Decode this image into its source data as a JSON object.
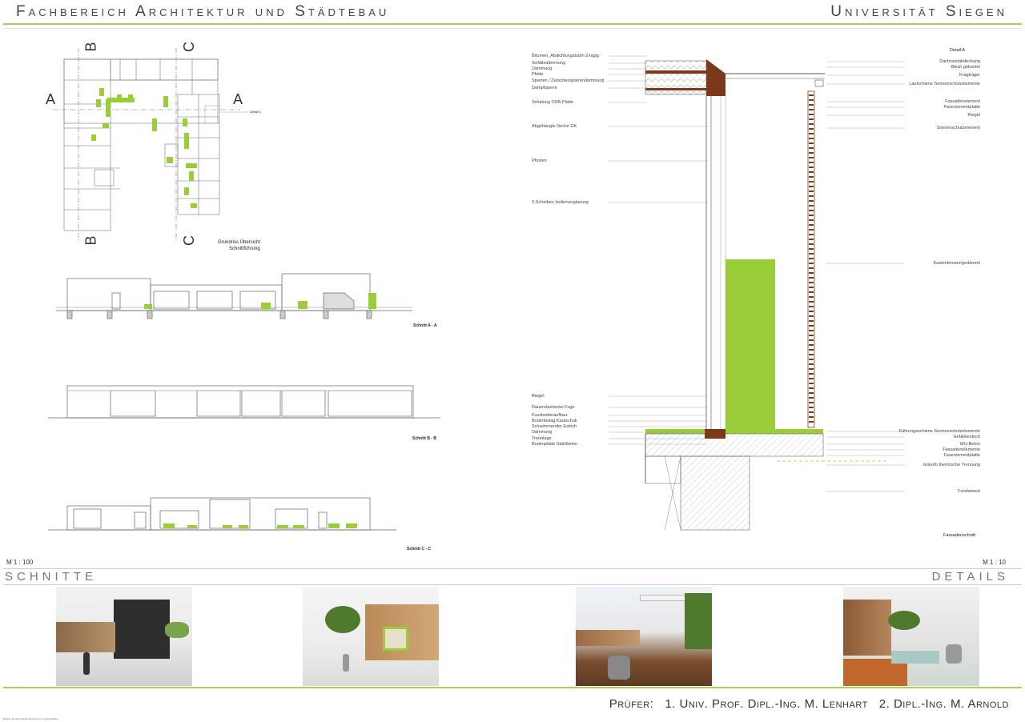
{
  "header": {
    "left_title": "Fachbereich Architektur und Städtebau",
    "right_title": "Universität Siegen"
  },
  "plan": {
    "axis_labels": {
      "a_left": "A",
      "a_right": "A",
      "b_top": "B",
      "b_bottom": "B",
      "c_top": "C",
      "c_bottom": "C"
    },
    "caption_line1": "Grundriss Übersicht",
    "caption_line2": "Schnittführung",
    "detail_ref": "Detail A"
  },
  "sections": {
    "aa_label": "Schnitt A - A",
    "bb_label": "Schnitt B - B",
    "cc_label": "Schnitt C - C",
    "scale_left": "M 1 : 100",
    "band_title": "SCHNITTE"
  },
  "detail": {
    "title": "Detail A",
    "bottom_caption": "Fassadenschnitt",
    "scale_right": "M 1 : 10",
    "band_title": "DETAILS",
    "left_labels": [
      "Bitumen_Abdichtungsbahn 2-lagig",
      "Gefälledämmung",
      "Dämmung",
      "Pfette",
      "Sparren / Zwischensparrendämmung",
      "Dampfsperre",
      "Schalung OSB-Platte",
      "Abgehängte Decke GK",
      "Pfosten",
      "2-Scheiben Isolierverglasung",
      "Riegel",
      "Dauerelastische Fuge",
      "Fussbodenaufbau:",
      "Bodenbelag Kautschuk",
      "Schwimmender Estrich",
      "Dämmung",
      "Trennlage",
      "Bodenplatte Stahlbeton"
    ],
    "right_labels": [
      "Dachrandabdeckung",
      "Blech gekantet",
      "Kragträger",
      "Laufschiene Sonnenschutzelemente",
      "Fassadenelement",
      "Faserzementplatte",
      "Riegel",
      "Sonnenschutzelement",
      "Kastenfenster/gedämmt",
      "Führungsschiene Sonnenschutzelemente",
      "Gefälleestrich",
      "WU-Beton",
      "Fassadenelemente",
      "Faserzementplatte",
      "Isokorb thermische Trennung",
      "Fundament"
    ]
  },
  "footer": {
    "examiners": "Prüfer:   1. Univ. Prof. Dipl.-Ing. M. Lenhart   2. Dipl.-Ing. M. Arnold",
    "small_note": "Erstellt mit einer Studentenversion von Vectorworks"
  },
  "colors": {
    "accent": "#a8d05a",
    "green_fill": "#9bcc3a",
    "wood": "#7a3a1a",
    "line": "#555555"
  }
}
